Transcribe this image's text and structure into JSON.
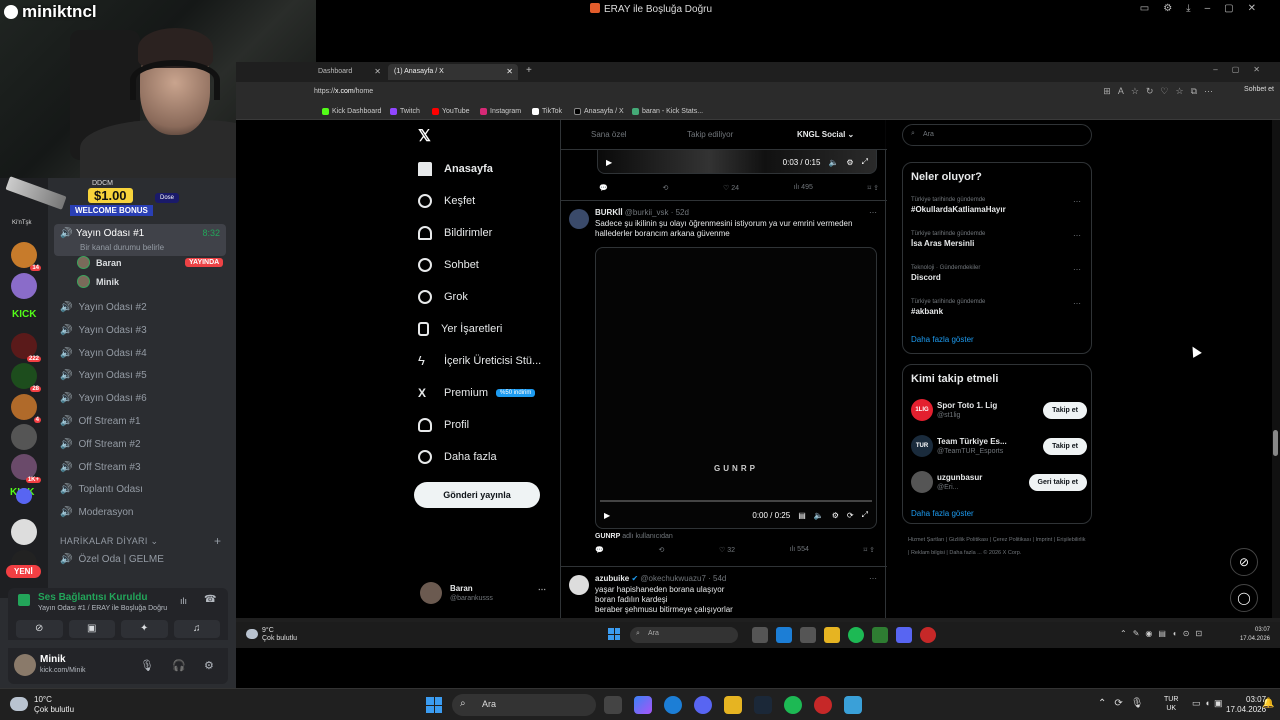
{
  "window": {
    "title": "ERAY ile Boşluğa Doğru"
  },
  "streamer": {
    "name": "miniktncl"
  },
  "overlay": {
    "amount": "$1.00",
    "label": "WELCOME BONUS",
    "brand": "Dose",
    "top_text": "DDCM"
  },
  "discord": {
    "guild_badges": [
      "14",
      "222",
      "28",
      "4",
      "1K+"
    ],
    "guild_labels": {
      "top": "Ki'nTşk",
      "kick": "KICK",
      "new": "YENİ"
    },
    "active_channel": {
      "name": "Yayın Odası #1",
      "time": "8:32",
      "status": "Bir kanal durumu belirle"
    },
    "members": [
      {
        "name": "Baran",
        "live": "YAYINDA"
      },
      {
        "name": "Minik",
        "live": ""
      }
    ],
    "channels": [
      "Yayın Odası #2",
      "Yayın Odası #3",
      "Yayın Odası #4",
      "Yayın Odası #5",
      "Yayın Odası #6",
      "Off Stream #1",
      "Off Stream #2",
      "Off Stream #3",
      "Toplantı Odası",
      "Moderasyon"
    ],
    "category": "HARİKALAR DİYARI",
    "private_room": "Özel Oda | GELME",
    "voice": {
      "status": "Ses Bağlantısı Kuruldu",
      "detail": "Yayın Odası #1 / ERAY ile Boşluğa Doğru"
    },
    "user": {
      "name": "Minik",
      "status": "kick.com/Minik"
    }
  },
  "browser": {
    "tabs": [
      {
        "label": "Dashboard"
      },
      {
        "label": "(1) Anasayfa / X"
      }
    ],
    "url_prefix": "https://",
    "url_host": "x.com",
    "url_path": "/home",
    "sohbet": "Sohbet et",
    "bookmarks": [
      "Kick Dashboard",
      "Twitch",
      "YouTube",
      "Instagram",
      "TikTok",
      "Anasayfa / X",
      "baran - Kick Stats..."
    ]
  },
  "x": {
    "nav": [
      {
        "label": "Anasayfa",
        "icon": "home-icon"
      },
      {
        "label": "Keşfet",
        "icon": "search-icon"
      },
      {
        "label": "Bildirimler",
        "icon": "bell-icon"
      },
      {
        "label": "Sohbet",
        "icon": "chat-icon"
      },
      {
        "label": "Grok",
        "icon": "grok-icon"
      },
      {
        "label": "Yer İşaretleri",
        "icon": "bookmark-icon"
      },
      {
        "label": "İçerik Üreticisi Stü...",
        "icon": "lightning-icon"
      },
      {
        "label": "Premium",
        "icon": "x-premium-icon",
        "badge": "%50 indirim"
      },
      {
        "label": "Profil",
        "icon": "profile-icon"
      },
      {
        "label": "Daha fazla",
        "icon": "more-icon"
      }
    ],
    "post_button": "Gönderi yayınla",
    "me": {
      "name": "Baran",
      "handle": "@barankusss"
    },
    "timeline_tabs": [
      "Sana özel",
      "Takip ediliyor",
      "KNGL Social ⌄"
    ],
    "video1": {
      "time": "0:03 / 0:15",
      "stats": [
        "",
        "",
        "24",
        "495",
        "",
        ""
      ]
    },
    "tweet1": {
      "name": "BURKİİ",
      "handle": "@burkii_vsk · 52d",
      "text": "Sadece şu ikilinin şu olayı öğrenmesini istiyorum ya vur emrini vermeden hallederler borancım arkana güvenme",
      "video_label": "GUNRP",
      "video_time": "0:00 / 0:25",
      "via": "GUNRP",
      "via_suffix": " adlı kullanıcıdan",
      "stats": [
        "",
        "",
        "32",
        "554",
        "",
        ""
      ]
    },
    "tweet2": {
      "name": "azubuike",
      "handle": "@okechukwuazu7 · 54d",
      "text": "yaşar hapishaneden borana ulaşıyor\nboran fadılın kardeşi\nberaber şehmusu bitirmeye çalışıyorlar"
    },
    "search_placeholder": "Ara",
    "trends_title": "Neler oluyor?",
    "trends": [
      {
        "meta": "Türkiye tarihinde gündemde",
        "name": "#OkullardaKatliamaHayır"
      },
      {
        "meta": "Türkiye tarihinde gündemde",
        "name": "İsa Aras Mersinli"
      },
      {
        "meta": "Teknoloji · Gündemdekiler",
        "name": "Discord"
      },
      {
        "meta": "Türkiye tarihinde gündemde",
        "name": "#akbank"
      }
    ],
    "trends_more": "Daha fazla göster",
    "follow_title": "Kimi takip etmeli",
    "follow": [
      {
        "name": "Spor Toto 1. Lig",
        "handle": "@st1lig",
        "button": "Takip et",
        "avatar": "1LIG",
        "color": "#e4202f"
      },
      {
        "name": "Team Türkiye Es...",
        "handle": "@TeamTUR_Esports",
        "button": "Takip et",
        "avatar": "TUR",
        "color": "#1a2b3c"
      },
      {
        "name": "uzgunbasur",
        "handle": "@Eri...",
        "button": "Geri takip et",
        "avatar": "",
        "color": "#555555"
      }
    ],
    "follow_more": "Daha fazla göster",
    "footer": "Hizmet Şartları | Gizlilik Politikası | Çerez Politikası | Imprint | Erişilebilirlik | Reklam bilgisi | Daha fazla ... © 2026 X Corp."
  },
  "inner_taskbar": {
    "temp": "9°C",
    "weather": "Çok bulutlu",
    "search": "Ara",
    "time": "03:07",
    "date": "17.04.2026"
  },
  "taskbar": {
    "temp": "10°C",
    "weather": "Çok bulutlu",
    "search": "Ara",
    "lang1": "TUR",
    "lang2": "UK",
    "time": "03:07",
    "date": "17.04.2026"
  },
  "colors": {
    "accent": "#1d9bf0",
    "kick": "#53fc18",
    "live": "#ed4245",
    "discord_green": "#23a55a"
  }
}
